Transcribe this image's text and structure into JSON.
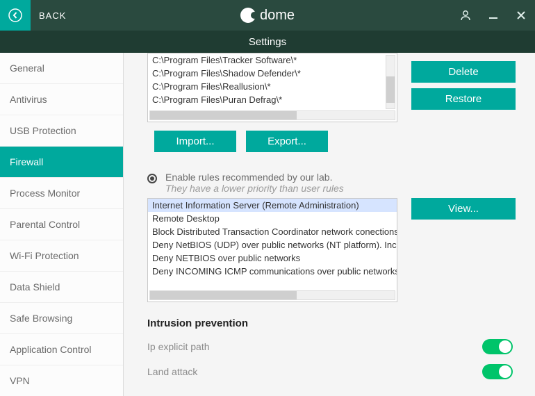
{
  "titlebar": {
    "back_label": "BACK",
    "brand": "dome"
  },
  "subheader": "Settings",
  "sidebar": {
    "items": [
      {
        "label": "General"
      },
      {
        "label": "Antivirus"
      },
      {
        "label": "USB Protection"
      },
      {
        "label": "Firewall",
        "active": true
      },
      {
        "label": "Process Monitor"
      },
      {
        "label": "Parental Control"
      },
      {
        "label": "Wi-Fi Protection"
      },
      {
        "label": "Data Shield"
      },
      {
        "label": "Safe Browsing"
      },
      {
        "label": "Application Control"
      },
      {
        "label": "VPN"
      }
    ]
  },
  "paths": [
    "C:\\Program Files\\Tracker Software\\*",
    "C:\\Program Files\\Shadow Defender\\*",
    "C:\\Program Files\\Reallusion\\*",
    "C:\\Program Files\\Puran Defrag\\*"
  ],
  "buttons": {
    "delete": "Delete",
    "restore": "Restore",
    "import": "Import...",
    "export": "Export...",
    "view": "View..."
  },
  "lab_rules": {
    "line1": "Enable rules recommended by our lab.",
    "line2": "They have a lower priority than user rules",
    "items": [
      {
        "label": "Internet Information Server (Remote Administration)",
        "selected": true
      },
      {
        "label": "Remote Desktop"
      },
      {
        "label": "Block Distributed Transaction Coordinator network conections on"
      },
      {
        "label": "Deny NetBIOS (UDP) over public networks (NT platform). Incomi"
      },
      {
        "label": "Deny NETBIOS over public networks"
      },
      {
        "label": "Deny INCOMING ICMP communications over public networks"
      }
    ]
  },
  "intrusion": {
    "heading": "Intrusion prevention",
    "rows": [
      {
        "label": "Ip explicit path",
        "on": true
      },
      {
        "label": "Land attack",
        "on": true
      }
    ]
  }
}
